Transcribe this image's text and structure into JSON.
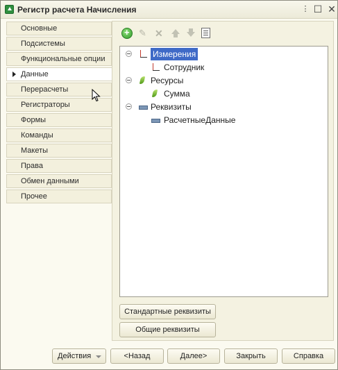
{
  "window": {
    "title": "Регистр расчета Начисления",
    "icon": "app-icon"
  },
  "tabs": [
    {
      "label": "Основные",
      "active": false
    },
    {
      "label": "Подсистемы",
      "active": false
    },
    {
      "label": "Функциональные опции",
      "active": false
    },
    {
      "label": "Данные",
      "active": true
    },
    {
      "label": "Перерасчеты",
      "active": false
    },
    {
      "label": "Регистраторы",
      "active": false
    },
    {
      "label": "Формы",
      "active": false
    },
    {
      "label": "Команды",
      "active": false
    },
    {
      "label": "Макеты",
      "active": false
    },
    {
      "label": "Права",
      "active": false
    },
    {
      "label": "Обмен данными",
      "active": false
    },
    {
      "label": "Прочее",
      "active": false
    }
  ],
  "toolbar": {
    "icons": [
      "add-icon",
      "edit-icon",
      "delete-icon",
      "move-up-icon",
      "move-down-icon",
      "list-icon"
    ]
  },
  "tree": {
    "dimensions": {
      "label": "Измерения",
      "children": [
        "Сотрудник"
      ]
    },
    "resources": {
      "label": "Ресурсы",
      "children": [
        "Сумма"
      ]
    },
    "attributes": {
      "label": "Реквизиты",
      "children": [
        "РасчетныеДанные"
      ]
    }
  },
  "buttons": {
    "standard_attributes": "Стандартные реквизиты",
    "common_attributes": "Общие реквизиты",
    "actions": "Действия",
    "back": "<Назад",
    "next": "Далее>",
    "close": "Закрыть",
    "help": "Справка"
  },
  "colors": {
    "selection": "#3f6ac7",
    "background": "#fbfaf0",
    "tab_background": "#f3f0dd"
  }
}
